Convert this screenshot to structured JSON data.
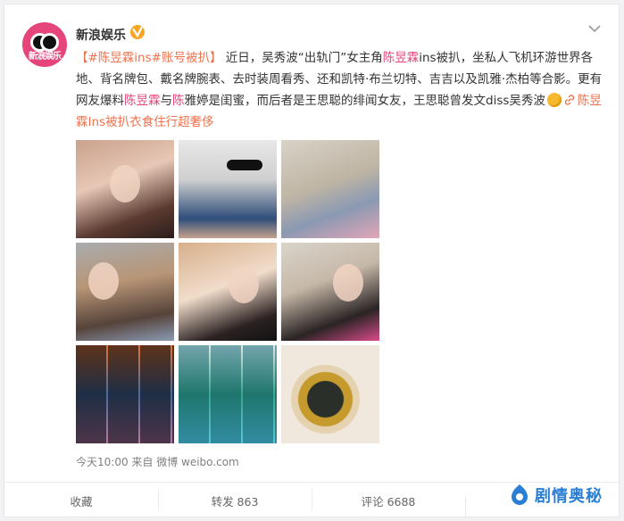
{
  "account": {
    "name": "新浪娱乐",
    "avatar_text": "新浪娱乐"
  },
  "post": {
    "topic": "【#陈昱霖ins#账号被扒】",
    "t1": " 近日，吴秀波“出轨门”女主角",
    "name1": "陈昱霖",
    "t2": "ins被扒，坐私人飞机环游世界各地、背名牌包、戴名牌腕表、去时装周看秀、还和凯特·布兰切特、吉吉以及凯雅·杰柏等合影。更有网友爆料",
    "name2": "陈昱霖",
    "t3": "与",
    "name3": "陈",
    "t4": "雅婷是闺蜜，而后者是王思聪的绯闻女友，王思聪曾发文diss吴秀波",
    "link_text": "陈昱霖Ins被扒衣食住行超奢侈"
  },
  "photos": [
    {
      "id": "photo-1"
    },
    {
      "id": "photo-2"
    },
    {
      "id": "photo-3"
    },
    {
      "id": "photo-4"
    },
    {
      "id": "photo-5"
    },
    {
      "id": "photo-6"
    },
    {
      "id": "photo-7"
    },
    {
      "id": "photo-8"
    },
    {
      "id": "photo-9"
    }
  ],
  "meta": {
    "time_source": "今天10:00 来自 微博 weibo.com"
  },
  "actions": {
    "favorite": "收藏",
    "repost": "转发 863",
    "comment": "评论 6688",
    "like": ""
  },
  "watermark": {
    "text": "剧情奥秘"
  },
  "colors": {
    "link": "#eb7350",
    "highlight": "#e5457a",
    "verified": "#f5a623",
    "watermark": "#2a7fd4"
  },
  "icons": [
    "verified-icon",
    "chevron-down-icon",
    "emoji-icon",
    "link-icon",
    "watermark-logo-icon"
  ]
}
